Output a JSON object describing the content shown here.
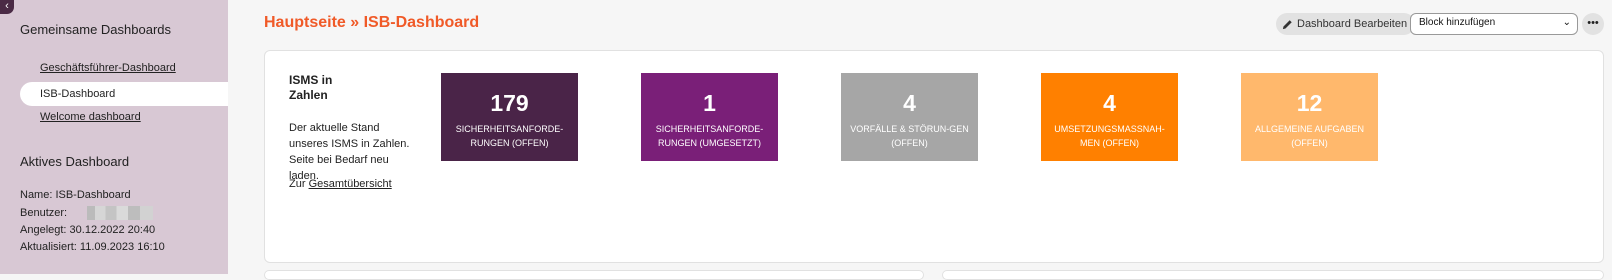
{
  "sidebar": {
    "collapse_icon": "‹",
    "shared_heading": "Gemeinsame Dashboards",
    "dashboards": [
      {
        "label": "Geschäftsführer-Dashboard",
        "active": false
      },
      {
        "label": "ISB-Dashboard",
        "active": true
      },
      {
        "label": "Welcome dashboard",
        "active": false
      }
    ],
    "active_heading": "Aktives Dashboard",
    "meta": {
      "name": "Name: ISB-Dashboard",
      "user_label": "Benutzer:",
      "created": "Angelegt: 30.12.2022 20:40",
      "updated": "Aktualisiert: 11.09.2023 16:10"
    }
  },
  "header": {
    "title": "Hauptseite » ISB-Dashboard",
    "edit_button": "Dashboard Bearbeiten",
    "edit_icon": "pencil-icon",
    "add_block_select": "Block hinzufügen",
    "more_icon": "•••"
  },
  "card": {
    "title": "ISMS in Zahlen",
    "description": "Der aktuelle Stand unseres ISMS in Zahlen. Seite bei Bedarf neu laden.",
    "link_prefix": "Zur",
    "link_text": "Gesamtübersicht",
    "tiles": [
      {
        "value": "179",
        "label": "Sicherheitsanforde-rungen (offen)",
        "color": "#4a2448",
        "text_color": "#ffffff"
      },
      {
        "value": "1",
        "label": "Sicherheitsanforde-rungen (umgesetzt)",
        "color": "#7a1f78",
        "text_color": "#ffffff"
      },
      {
        "value": "4",
        "label": "Vorfälle & Störun-gen (offen)",
        "color": "#a6a6a6",
        "text_color": "#ffffff"
      },
      {
        "value": "4",
        "label": "Umsetzungsmassnah-men (offen)",
        "color": "#ff8000",
        "text_color": "#ffffff"
      },
      {
        "value": "12",
        "label": "Allgemeine Aufgaben (offen)",
        "color": "#ffb86c",
        "text_color": "#ffffff"
      }
    ]
  }
}
